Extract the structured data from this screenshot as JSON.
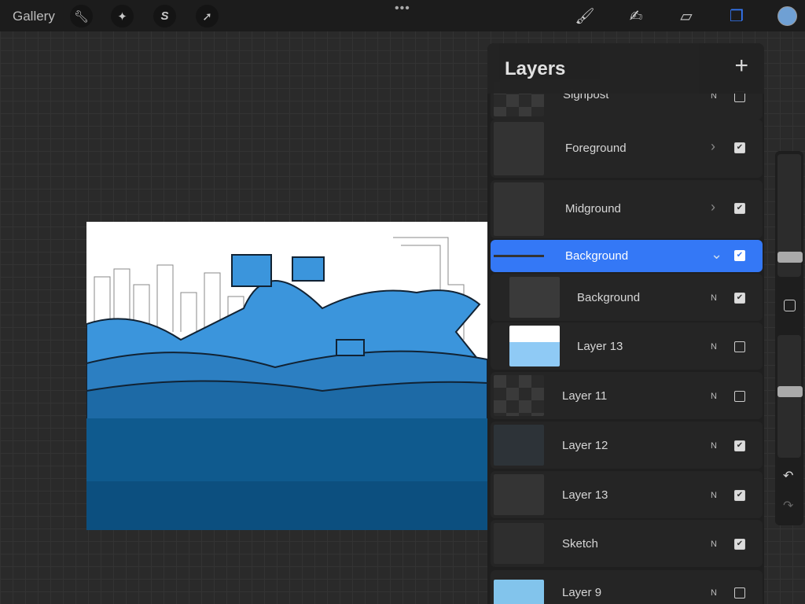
{
  "topbar": {
    "gallery": "Gallery",
    "actions": [
      "wrench-icon",
      "magic-wand-icon",
      "selection-s-icon",
      "move-arrow-icon"
    ],
    "more": "•••",
    "tools": [
      "brush-icon",
      "smudge-icon",
      "eraser-icon",
      "layers-icon"
    ],
    "current_color": "#6fa0d4"
  },
  "layers": {
    "title": "Layers",
    "add": "+",
    "accent": "#3478f6",
    "items": [
      {
        "name": "Signpost",
        "mode": "N",
        "visible": false
      },
      {
        "name": "Foreground",
        "group": true,
        "visible": true
      },
      {
        "name": "Midground",
        "group": true,
        "visible": true
      },
      {
        "name": "Background",
        "group": true,
        "expanded": true,
        "selected": true,
        "visible": true
      },
      {
        "name": "Background",
        "mode": "N",
        "visible": true
      },
      {
        "name": "Layer 13",
        "mode": "N",
        "visible": false
      },
      {
        "name": "Layer 11",
        "mode": "N",
        "visible": false
      },
      {
        "name": "Layer 12",
        "mode": "N",
        "visible": true
      },
      {
        "name": "Layer 13",
        "mode": "N",
        "visible": true
      },
      {
        "name": "Sketch",
        "mode": "N",
        "visible": true
      },
      {
        "name": "Layer 9",
        "mode": "N",
        "visible": false
      }
    ]
  },
  "sidebar": {
    "brush_size": 0.2,
    "opacity": 0.4,
    "undo": "↶",
    "redo": "↷"
  }
}
